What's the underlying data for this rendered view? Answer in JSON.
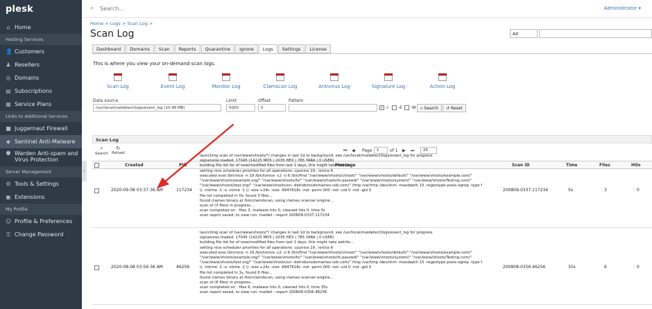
{
  "app": {
    "logo": "plesk"
  },
  "sidebar": {
    "items": [
      {
        "type": "item",
        "label": "Home",
        "icon": "home-icon",
        "glyph": "⌂"
      },
      {
        "type": "section",
        "label": "Hosting Services"
      },
      {
        "type": "item",
        "label": "Customers",
        "icon": "customers-icon",
        "glyph": "👤"
      },
      {
        "type": "item",
        "label": "Resellers",
        "icon": "resellers-icon",
        "glyph": "♟"
      },
      {
        "type": "item",
        "label": "Domains",
        "icon": "domains-icon",
        "glyph": "◎"
      },
      {
        "type": "item",
        "label": "Subscriptions",
        "icon": "subscriptions-icon",
        "glyph": "▤"
      },
      {
        "type": "item",
        "label": "Service Plans",
        "icon": "service-plans-icon",
        "glyph": "▦"
      },
      {
        "type": "section",
        "label": "Links to Additional Services"
      },
      {
        "type": "item",
        "label": "Juggernaut Firewall",
        "icon": "firewall-icon",
        "glyph": "■"
      },
      {
        "type": "item",
        "label": "Sentinel Anti-Malware",
        "icon": "shield-icon",
        "glyph": "◆",
        "active": true
      },
      {
        "type": "item2",
        "label": "Warden Anti-spam and",
        "label2": "Virus Protection",
        "icon": "warden-icon",
        "glyph": "●"
      },
      {
        "type": "section",
        "label": "Server Management"
      },
      {
        "type": "item",
        "label": "Tools & Settings",
        "icon": "tools-icon",
        "glyph": "⚙"
      },
      {
        "type": "item",
        "label": "Extensions",
        "icon": "extensions-icon",
        "glyph": "▣"
      },
      {
        "type": "section",
        "label": "My Profile"
      },
      {
        "type": "item",
        "label": "Profile & Preferences",
        "icon": "profile-icon",
        "glyph": "☺"
      },
      {
        "type": "item",
        "label": "Change Password",
        "icon": "key-icon",
        "glyph": "⚿"
      }
    ]
  },
  "topbar": {
    "search_placeholder": "Search...",
    "user": "Administrator ▾"
  },
  "breadcrumb": "Home  >  Logs  >  Scan Log  >",
  "page_title": "Scan Log",
  "filter": {
    "selected": "All"
  },
  "tabs": [
    {
      "label": "Dashboard"
    },
    {
      "label": "Domains"
    },
    {
      "label": "Scan"
    },
    {
      "label": "Reports"
    },
    {
      "label": "Quarantine"
    },
    {
      "label": "Ignore"
    },
    {
      "label": "Logs",
      "active": true
    },
    {
      "label": "Settings"
    },
    {
      "label": "License"
    }
  ],
  "intro": "This is where you view your on-demand scan logs.",
  "log_links": [
    {
      "label": "Scan Log"
    },
    {
      "label": "Event Log"
    },
    {
      "label": "Monitor Log"
    },
    {
      "label": "Clamscan Log"
    },
    {
      "label": "Antivirus Log"
    },
    {
      "label": "Signature Log"
    },
    {
      "label": "Action Log"
    }
  ],
  "form": {
    "source_label": "Data source",
    "source_value": "/usr/local/maldetect/logs/event_log (10.48 MB)",
    "limit_label": "Limit",
    "limit_value": "5000",
    "offset_label": "Offset",
    "offset_value": "0",
    "pattern_label": "Pattern",
    "pattern_value": "",
    "opt_i": "-i",
    "opt_e": "-E",
    "opt_w": "-W",
    "search_btn": "Search",
    "reset_btn": "Reset"
  },
  "panel": {
    "title": "Scan Log",
    "search_label": "Search",
    "reload_label": "Reload",
    "page_label": "Page",
    "page_value": "1",
    "of_label": "of 1",
    "per_page": "25"
  },
  "columns": [
    "Created",
    "PID",
    "Message",
    "Scan ID",
    "Time",
    "Files",
    "Hits"
  ],
  "rows": [
    {
      "created": "2020-09-08 03:37:36 AM",
      "pid": "117234",
      "scan_id": "200809-0337.117234",
      "time": "5s",
      "files": "3",
      "hits": "0",
      "message": [
        "launching scan of /var/www/vhosts/*/ changes in last 1d to background, see /usr/local/maldetect/logs/event_log for progress",
        "signatures loaded: 17045 (14225 MD5 | 2035 HEX | 785 YARA | 0 USER)",
        "building file list for  of new/modified files from last 1 days, this might take awhile...",
        "setting nice scheduler priorities for all operations: cpunice 19 , ionice 6",
        "executed eval /bin/nice -n 19 /bin/ionice -c2 -n 6 /bin/find \"/var/www/vhosts/chroot/\" \"/var/www/vhosts/default/\" \"/var/www/vhosts/example.com/\"",
        "\"/var/www/vhosts/example.org/\" \"/var/www/vhosts/fs/\" \"/var/www/vhosts/fs-passwd/\" \"/var/www/vhosts/system/\" \"/var/www/vhosts/Testing.com/\"",
        "\"/var/www/vhosts/test.org/\" \"/var/www/vhosts/xn--detrsbonsdomaines-vsb.com/\" /tmp /var/tmp /dev/shm -maxdepth 15 -regextype posix-egrep -type f",
        "\\( -mtime -1 -o -ctime -1 \\) -size +24c -size -6947618c  -not -perm 000   -not -uid 0 -not -gid 0",
        "file list completed in 0s, found 3 files...",
        "found clamav binary at /bin/clamdscan, using clamav scanner engine...",
        "scan of  (3 files) in progress...",
        "scan completed on : files 3, malware hits 0, cleaned hits 0, time 5s",
        "scan report saved, to view run: maldet --report 200809-0337.117234"
      ]
    },
    {
      "created": "2020-08-08 03:56:36 AM",
      "pid": "46256",
      "scan_id": "200808-0356.46256",
      "time": "35s",
      "files": "6",
      "hits": "0",
      "message": [
        "launching scan of /var/www/vhosts/*/ changes in last 1d to background, see /usr/local/maldetect/logs/event_log for progress",
        "signatures loaded: 17045 (14225 MD5 | 2035 HEX | 785 YARA | 0 USER)",
        "building file list for  of new/modified files from last 1 days, this might take awhile...",
        "setting nice scheduler priorities for all operations: cpunice 19 , ionice 6",
        "executed eval /bin/nice -n 19 /bin/ionice -c2 -n 6 /bin/find \"/var/www/vhosts/chroot/\" \"/var/www/vhosts/default/\" \"/var/www/vhosts/example.com/\"",
        "\"/var/www/vhosts/example.org/\" \"/var/www/vhosts/fs/\" \"/var/www/vhosts/fs-passwd/\" \"/var/www/vhosts/system/\" \"/var/www/vhosts/Testing.com/\"",
        "\"/var/www/vhosts/test.org/\" \"/var/www/vhosts/xn--detrsbonsdomaines-vsb.com/\" /tmp /var/tmp /dev/shm -maxdepth 15 -regextype posix-egrep -type f",
        "\\( -mtime -1 -o -ctime -1 \\) -size +24c -size -6947618c  -not -perm 000   -not -uid 0 -not -gid 0",
        "file list completed in 1s, found 6 files...",
        "found clamav binary at /bin/clamdscan, using clamav scanner engine...",
        "scan of  (6 files) in progress...",
        "scan completed on : files 6, malware hits 0, cleaned hits 0, time 35s",
        "scan report saved, to view run: maldet --report 200808-0356.46256"
      ]
    }
  ],
  "colors": {
    "sidebar_bg": "#2e3a46",
    "link": "#3572b6",
    "arrow": "#e02a2a"
  }
}
